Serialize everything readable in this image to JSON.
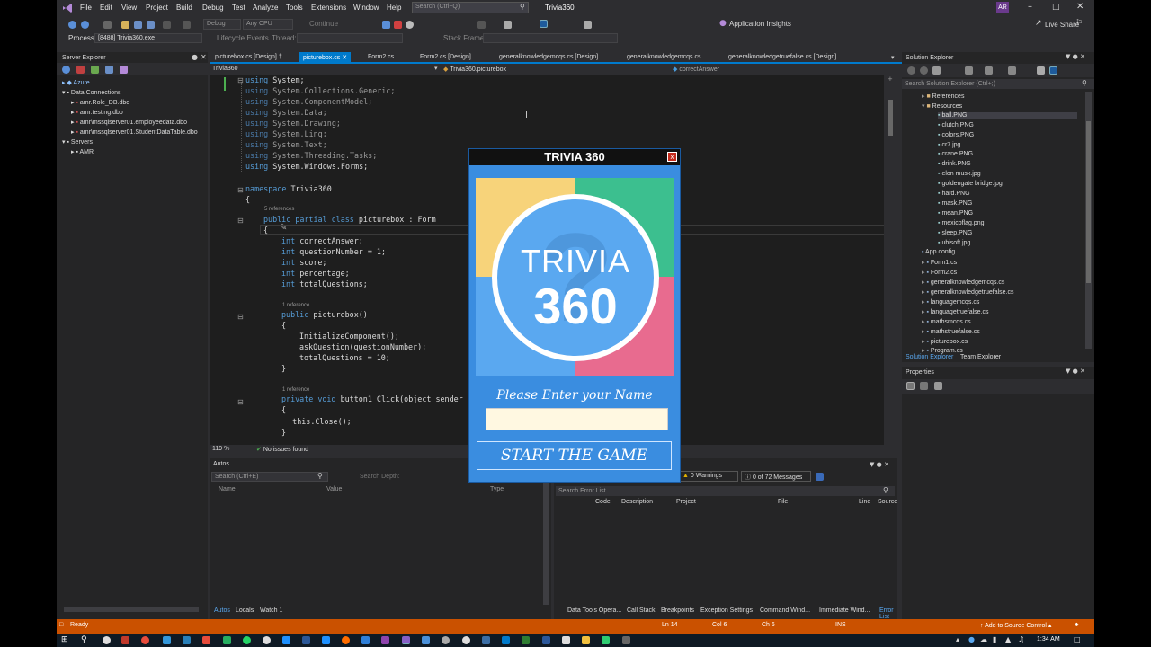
{
  "colors": {
    "ide_bg": "#2d2d30",
    "editor_bg": "#1e1e1e",
    "status_bar": "#ca5100",
    "accent": "#007acc",
    "trivia_bg": "#3a8de0"
  },
  "menu": [
    "File",
    "Edit",
    "View",
    "Project",
    "Build",
    "Debug",
    "Test",
    "Analyze",
    "Tools",
    "Extensions",
    "Window",
    "Help"
  ],
  "search_placeholder": "Search (Ctrl+Q)",
  "solution_name": "Trivia360",
  "user_initials": "AR",
  "toolbar": {
    "config": "Debug",
    "platform": "Any CPU",
    "continue": "Continue",
    "app_insights": "Application Insights",
    "live_share": "Live Share",
    "process_label": "Process:",
    "process_value": "[8488] Trivia360.exe",
    "lifecycle": "Lifecycle Events",
    "thread": "Thread:",
    "stack_frame": "Stack Frame:"
  },
  "server_explorer": {
    "title": "Server Explorer",
    "items": [
      "Azure",
      "Data Connections",
      "amr.Role_DB.dbo",
      "amr.testing.dbo",
      "amr\\mssqlserver01.employeedata.dbo",
      "amr\\mssqlserver01.StudentDataTable.dbo",
      "Servers",
      "AMR"
    ]
  },
  "tabs": [
    "picturebox.cs [Design]",
    "picturebox.cs",
    "Form2.cs",
    "Form2.cs [Design]",
    "generalknowledgemcqs.cs [Design]",
    "generalknowledgemcqs.cs",
    "generalknowledgetruefalse.cs [Design]"
  ],
  "nav": {
    "project": "Trivia360",
    "class": "Trivia360.picturebox",
    "member": "correctAnswer"
  },
  "code": {
    "using1": "System;",
    "using2": "System.Collections.Generic;",
    "using3": "System.ComponentModel;",
    "using4": "System.Data;",
    "using5": "System.Drawing;",
    "using6": "System.Linq;",
    "using7": "System.Text;",
    "using8": "System.Threading.Tasks;",
    "using9": "System.Windows.Forms;",
    "namespace": "Trivia360",
    "refs5": "5 references",
    "class_line": "picturebox : Form",
    "field1": "correctAnswer;",
    "field2": "questionNumber = 1;",
    "field3": "score;",
    "field4": "percentage;",
    "field5": "totalQuestions;",
    "ref1": "1 reference",
    "ctor": "picturebox()",
    "init": "InitializeComponent();",
    "ask": "askQuestion(questionNumber);",
    "total": "totalQuestions = 10;",
    "ref2": "1 reference",
    "click": "button1_Click(object sender",
    "close": "this.Close();"
  },
  "editor_status": {
    "zoom": "119 %",
    "issues": "No issues found"
  },
  "autos": {
    "title": "Autos",
    "search": "Search (Ctrl+E)",
    "depth": "Search Depth:",
    "cols": [
      "Name",
      "Value",
      "Type"
    ],
    "bottom_tabs": [
      "Autos",
      "Locals",
      "Watch 1"
    ]
  },
  "errors": {
    "warnings": "0 Warnings",
    "messages": "0 of 72 Messages",
    "search": "Search Error List",
    "cols": [
      "Code",
      "Description",
      "Project",
      "File",
      "Line",
      "Source"
    ],
    "bottom_tabs": [
      "Data Tools Opera...",
      "Call Stack",
      "Breakpoints",
      "Exception Settings",
      "Command Wind...",
      "Immediate Wind...",
      "Error List"
    ]
  },
  "solution_explorer": {
    "title": "Solution Explorer",
    "search": "Search Solution Explorer (Ctrl+;)",
    "items": [
      "References",
      "Resources",
      "ball.PNG",
      "clutch.PNG",
      "colors.PNG",
      "cr7.jpg",
      "crane.PNG",
      "drink.PNG",
      "elon musk.jpg",
      "goldengate bridge.jpg",
      "hard.PNG",
      "mask.PNG",
      "mean.PNG",
      "mexicoflag.png",
      "sleep.PNG",
      "ubisoft.jpg",
      "App.config",
      "Form1.cs",
      "Form2.cs",
      "generalknowledgemcqs.cs",
      "generalknowledgetruefalse.cs",
      "languagemcqs.cs",
      "languagetruefalse.cs",
      "mathsmcqs.cs",
      "mathstruefalse.cs",
      "picturebox.cs",
      "Program.cs"
    ],
    "tabs": [
      "Solution Explorer",
      "Team Explorer"
    ]
  },
  "properties": {
    "title": "Properties"
  },
  "status": {
    "ready": "Ready",
    "ln": "Ln 14",
    "col": "Col 6",
    "ch": "Ch 6",
    "ins": "INS",
    "source_control": "Add to Source Control"
  },
  "taskbar": {
    "time": "1:34 AM"
  },
  "trivia": {
    "title": "TRIVIA 360",
    "close": "x",
    "logo_line1": "TRIVIA",
    "logo_line2": "360",
    "qmark": "?",
    "name_label": "Please Enter your Name",
    "start": "START THE GAME"
  }
}
